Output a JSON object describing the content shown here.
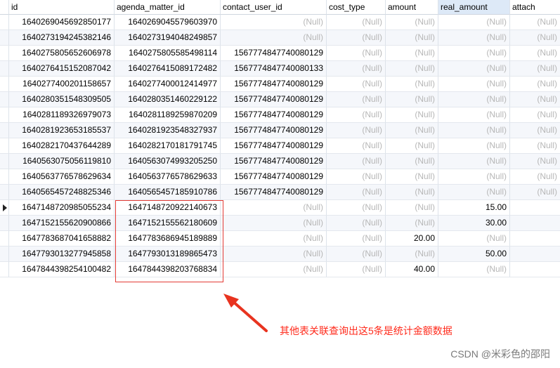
{
  "table": {
    "columns": [
      "id",
      "agenda_matter_id",
      "contact_user_id",
      "cost_type",
      "amount",
      "real_amount",
      "attach"
    ],
    "selected_column": "real_amount",
    "null_text": "(Null)",
    "rows": [
      [
        "1640269045692850177",
        "1640269045579603970",
        "(Null)",
        "(Null)",
        "(Null)",
        "(Null)",
        "(Null)"
      ],
      [
        "1640273194245382146",
        "1640273194048249857",
        "(Null)",
        "(Null)",
        "(Null)",
        "(Null)",
        "(Null)"
      ],
      [
        "1640275805652606978",
        "1640275805585498114",
        "1567774847740080129",
        "(Null)",
        "(Null)",
        "(Null)",
        "(Null)"
      ],
      [
        "1640276415152087042",
        "1640276415089172482",
        "1567774847740080133",
        "(Null)",
        "(Null)",
        "(Null)",
        "(Null)"
      ],
      [
        "1640277400201158657",
        "1640277400012414977",
        "1567774847740080129",
        "(Null)",
        "(Null)",
        "(Null)",
        "(Null)"
      ],
      [
        "1640280351548309505",
        "1640280351460229122",
        "1567774847740080129",
        "(Null)",
        "(Null)",
        "(Null)",
        "(Null)"
      ],
      [
        "1640281189326979073",
        "1640281189259870209",
        "1567774847740080129",
        "(Null)",
        "(Null)",
        "(Null)",
        "(Null)"
      ],
      [
        "1640281923653185537",
        "1640281923548327937",
        "1567774847740080129",
        "(Null)",
        "(Null)",
        "(Null)",
        "(Null)"
      ],
      [
        "1640282170437644289",
        "1640282170181791745",
        "1567774847740080129",
        "(Null)",
        "(Null)",
        "(Null)",
        "(Null)"
      ],
      [
        "1640563075056119810",
        "1640563074993205250",
        "1567774847740080129",
        "(Null)",
        "(Null)",
        "(Null)",
        "(Null)"
      ],
      [
        "1640563776578629634",
        "1640563776578629633",
        "1567774847740080129",
        "(Null)",
        "(Null)",
        "(Null)",
        "(Null)"
      ],
      [
        "1640565457248825346",
        "1640565457185910786",
        "1567774847740080129",
        "(Null)",
        "(Null)",
        "(Null)",
        "(Null)"
      ],
      [
        "1647148720985055234",
        "1647148720922140673",
        "(Null)",
        "(Null)",
        "(Null)",
        "15.00",
        ""
      ],
      [
        "1647152155620900866",
        "1647152155562180609",
        "(Null)",
        "(Null)",
        "(Null)",
        "30.00",
        ""
      ],
      [
        "1647783687041658882",
        "1647783686945189889",
        "(Null)",
        "(Null)",
        "20.00",
        "(Null)",
        ""
      ],
      [
        "1647793013277945858",
        "1647793013189865473",
        "(Null)",
        "(Null)",
        "(Null)",
        "50.00",
        ""
      ],
      [
        "1647844398254100482",
        "1647844398203768834",
        "(Null)",
        "(Null)",
        "40.00",
        "(Null)",
        ""
      ]
    ],
    "current_row_index": 12
  },
  "annotation": {
    "text": "其他表关联查询出这5条是统计金额数据",
    "color": "#ff2b1c"
  },
  "watermark": "CSDN @米彩色的邵阳"
}
